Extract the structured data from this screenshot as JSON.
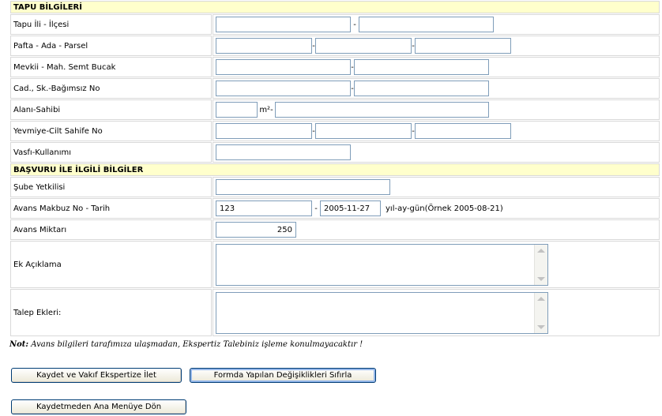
{
  "sections": {
    "tapu_title": "TAPU BİLGİLERİ",
    "basvuru_title": "BAŞVURU İLE İLGİLİ BİLGİLER"
  },
  "labels": {
    "il_ilce": "Tapu İli - İlçesi",
    "pafta": "Pafta - Ada - Parsel",
    "mevkii": "Mevkii - Mah. Semt Bucak",
    "cad": "Cad.,  Sk.-Bağımsız No",
    "alan": "Alanı-Sahibi",
    "yevmiye": "Yevmiye-Cilt Sahife No",
    "vasfi": "Vasfı-Kullanımı",
    "sube": "Şube Yetkilisi",
    "avans_makbuz": "Avans Makbuz No - Tarih",
    "avans_miktari": "Avans Miktarı",
    "ek_aciklama": "Ek Açıklama",
    "talep_ekleri": "Talep Ekleri:"
  },
  "separators": {
    "dash": "-",
    "m2": "m²-"
  },
  "values": {
    "makbuz_no": "123",
    "tarih": "2005-11-27",
    "date_hint": "yıl-ay-gün(Örnek 2005-08-21)",
    "avans_miktari": "250"
  },
  "note": {
    "prefix": "Not:",
    "text": " Avans bilgileri tarafımıza ulaşmadan, Ekspertiz Talebiniz işleme konulmayacaktır !"
  },
  "buttons": {
    "kaydet": "Kaydet ve Vakıf Ekspertize İlet",
    "sifirla": "Formda Yapılan Değişiklikleri Sıfırla",
    "ana_menu": "Kaydetmeden Ana Menüye Dön"
  }
}
